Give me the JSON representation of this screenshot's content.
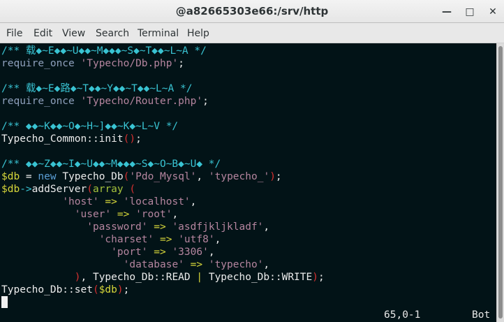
{
  "window": {
    "title": "@a82665303e66:/srv/http",
    "minimize_icon": "minimize-icon",
    "maximize_icon": "maximize-icon",
    "close_icon": "close-icon"
  },
  "menu": [
    "File",
    "Edit",
    "View",
    "Search",
    "Terminal",
    "Help"
  ],
  "code": [
    [
      [
        "/** 载◆~E◆◆~U◆◆~M◆◆◆~S◆~T◆◆~L~A */",
        "comment"
      ]
    ],
    [
      [
        "require_once ",
        "kw"
      ],
      [
        "'Typecho/Db.php'",
        "str"
      ],
      [
        ";",
        "plain"
      ]
    ],
    [],
    [
      [
        "/** 载◆~E◆路◆~T◆◆~Y◆◆~T◆◆~L~A */",
        "comment"
      ]
    ],
    [
      [
        "require_once ",
        "kw"
      ],
      [
        "'Typecho/Router.php'",
        "str"
      ],
      [
        ";",
        "plain"
      ]
    ],
    [],
    [
      [
        "/** ◆◆~K◆◆~O◆~H~]◆◆~K◆~L~V */",
        "comment"
      ]
    ],
    [
      [
        "Typecho_Common::init",
        "plain"
      ],
      [
        "()",
        "paren"
      ],
      [
        ";",
        "plain"
      ]
    ],
    [],
    [
      [
        "/** ◆◆~Z◆◆~I◆~U◆◆~M◆◆◆~S◆~O~B◆~U◆ */",
        "comment"
      ]
    ],
    [
      [
        "$db",
        "var"
      ],
      [
        " = ",
        "plain"
      ],
      [
        "new",
        "new"
      ],
      [
        " Typecho_Db",
        "plain"
      ],
      [
        "(",
        "paren"
      ],
      [
        "'Pdo_Mysql'",
        "str"
      ],
      [
        ", ",
        "plain"
      ],
      [
        "'typecho_'",
        "str"
      ],
      [
        ")",
        "paren"
      ],
      [
        ";",
        "plain"
      ]
    ],
    [
      [
        "$db",
        "var"
      ],
      [
        "->",
        "arrow"
      ],
      [
        "addServer",
        "plain"
      ],
      [
        "(",
        "paren"
      ],
      [
        "array",
        "arr"
      ],
      [
        " (",
        "paren"
      ]
    ],
    [
      [
        "          ",
        "plain"
      ],
      [
        "'host'",
        "str"
      ],
      [
        " => ",
        "op"
      ],
      [
        "'localhost'",
        "str"
      ],
      [
        ",",
        "plain"
      ]
    ],
    [
      [
        "            ",
        "plain"
      ],
      [
        "'user'",
        "str"
      ],
      [
        " => ",
        "op"
      ],
      [
        "'root'",
        "str"
      ],
      [
        ",",
        "plain"
      ]
    ],
    [
      [
        "              ",
        "plain"
      ],
      [
        "'password'",
        "str"
      ],
      [
        " => ",
        "op"
      ],
      [
        "'asdfjkljkladf'",
        "str"
      ],
      [
        ",",
        "plain"
      ]
    ],
    [
      [
        "                ",
        "plain"
      ],
      [
        "'charset'",
        "str"
      ],
      [
        " => ",
        "op"
      ],
      [
        "'utf8'",
        "str"
      ],
      [
        ",",
        "plain"
      ]
    ],
    [
      [
        "                  ",
        "plain"
      ],
      [
        "'port'",
        "str"
      ],
      [
        " => ",
        "op"
      ],
      [
        "'3306'",
        "str"
      ],
      [
        ",",
        "plain"
      ]
    ],
    [
      [
        "                    ",
        "plain"
      ],
      [
        "'database'",
        "str"
      ],
      [
        " => ",
        "op"
      ],
      [
        "'typecho'",
        "str"
      ],
      [
        ",",
        "plain"
      ]
    ],
    [
      [
        "            ",
        "plain"
      ],
      [
        ")",
        "paren"
      ],
      [
        ", Typecho_Db::READ ",
        "plain"
      ],
      [
        "|",
        "op"
      ],
      [
        " Typecho_Db::WRITE",
        "plain"
      ],
      [
        ")",
        "paren"
      ],
      [
        ";",
        "plain"
      ]
    ],
    [
      [
        "Typecho_Db::set",
        "plain"
      ],
      [
        "(",
        "paren"
      ],
      [
        "$db",
        "var"
      ],
      [
        ")",
        "paren"
      ],
      [
        ";",
        "plain"
      ]
    ]
  ],
  "status": {
    "position": "65,0-1",
    "scroll": "Bot"
  }
}
